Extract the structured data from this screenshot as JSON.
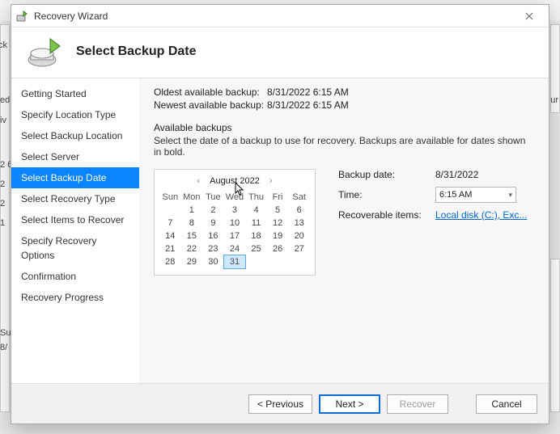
{
  "window": {
    "title": "Recovery Wizard"
  },
  "header": {
    "title": "Select Backup Date"
  },
  "sidebar": {
    "items": [
      {
        "label": "Getting Started"
      },
      {
        "label": "Specify Location Type"
      },
      {
        "label": "Select Backup Location"
      },
      {
        "label": "Select Server"
      },
      {
        "label": "Select Backup Date"
      },
      {
        "label": "Select Recovery Type"
      },
      {
        "label": "Select Items to Recover"
      },
      {
        "label": "Specify Recovery Options"
      },
      {
        "label": "Confirmation"
      },
      {
        "label": "Recovery Progress"
      }
    ],
    "selected_index": 4
  },
  "main": {
    "oldest_label": "Oldest available backup:",
    "oldest_value": "8/31/2022 6:15 AM",
    "newest_label": "Newest available backup:",
    "newest_value": "8/31/2022 6:15 AM",
    "available_title": "Available backups",
    "available_desc": "Select the date of a backup to use for recovery. Backups are available for dates shown in bold.",
    "backup_date_label": "Backup date:",
    "backup_date_value": "8/31/2022",
    "time_label": "Time:",
    "time_value": "6:15 AM",
    "recoverable_label": "Recoverable items:",
    "recoverable_value": "Local disk (C:), Exc..."
  },
  "calendar": {
    "title": "August 2022",
    "dow": [
      "Sun",
      "Mon",
      "Tue",
      "Wed",
      "Thu",
      "Fri",
      "Sat"
    ],
    "weeks": [
      [
        "",
        "1",
        "2",
        "3",
        "4",
        "5",
        "6"
      ],
      [
        "7",
        "8",
        "9",
        "10",
        "11",
        "12",
        "13"
      ],
      [
        "14",
        "15",
        "16",
        "17",
        "18",
        "19",
        "20"
      ],
      [
        "21",
        "22",
        "23",
        "24",
        "25",
        "26",
        "27"
      ],
      [
        "28",
        "29",
        "30",
        "31",
        "",
        "",
        ""
      ]
    ],
    "bold_days": [
      "31"
    ],
    "selected_day": "31"
  },
  "footer": {
    "prev": "< Previous",
    "next": "Next >",
    "recover": "Recover",
    "cancel": "Cancel"
  },
  "background": {
    "ck": "ck",
    "ed": "ed",
    "iv": "iv",
    "g2a": "2 6",
    "g2b": "2",
    "g2c": "2",
    "g1": "1",
    "su": "Su",
    "bb": "8/",
    "ur": "ur"
  }
}
